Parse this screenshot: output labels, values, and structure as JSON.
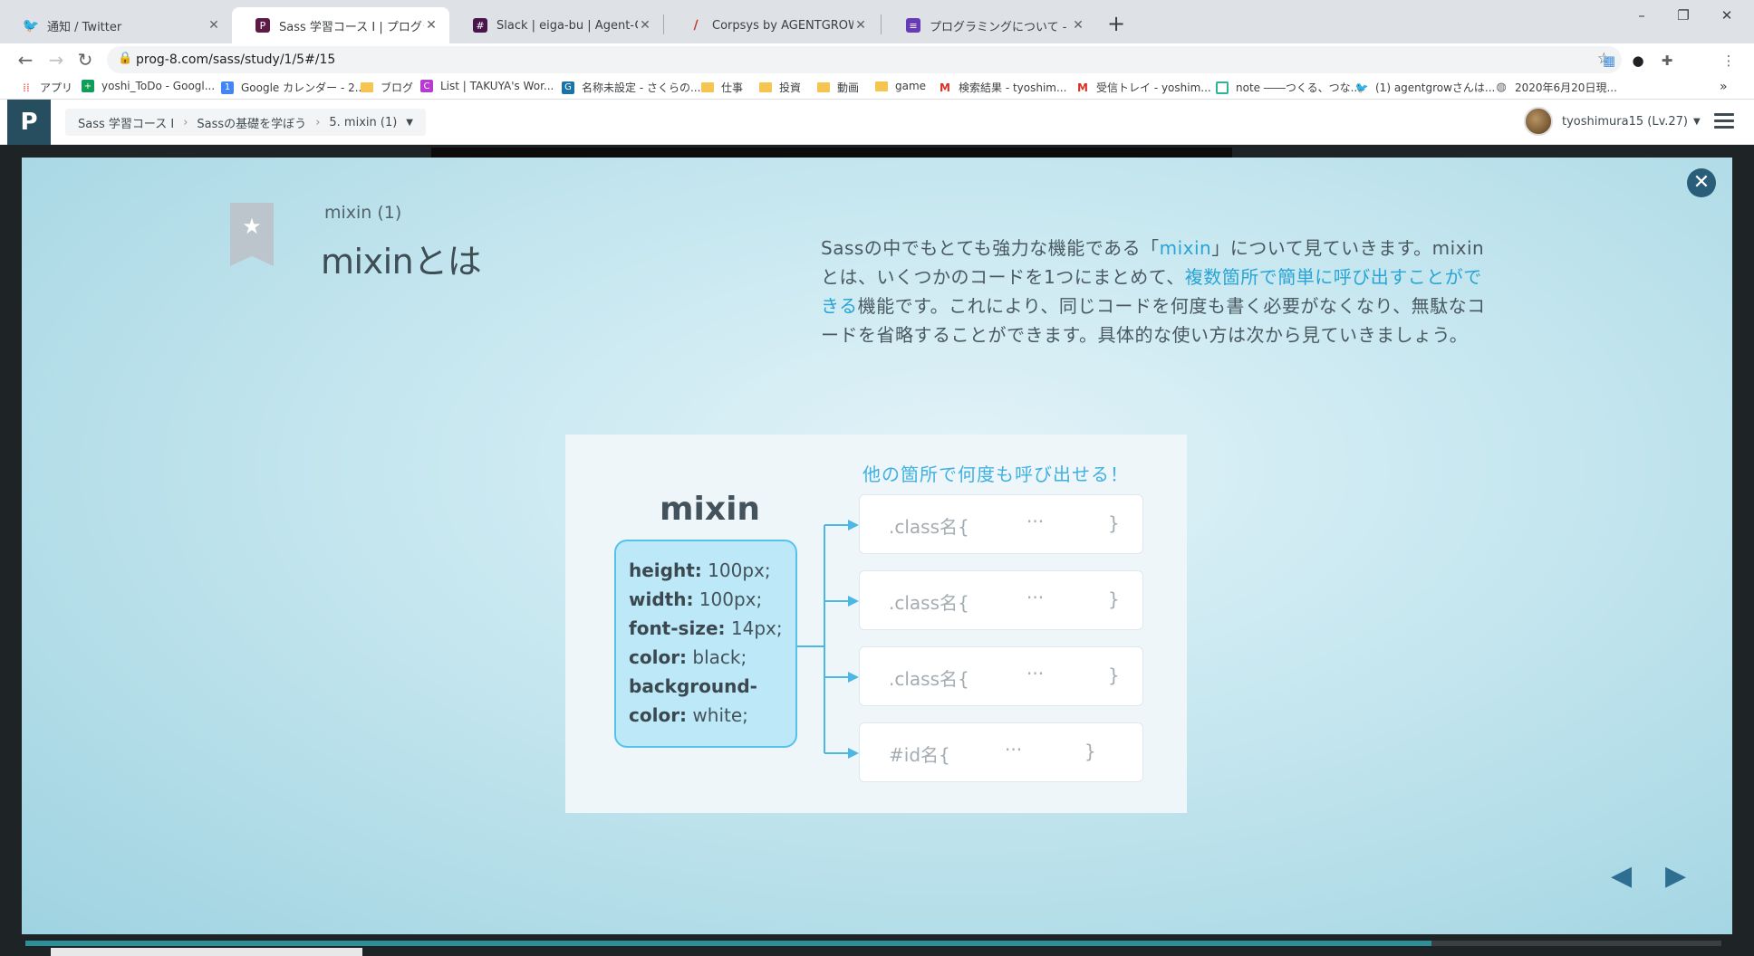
{
  "browser": {
    "tabs": [
      {
        "title": "通知 / Twitter",
        "icon": "twitter-icon",
        "color": "#1da1f2",
        "active": false
      },
      {
        "title": "Sass 学習コース I | プログラミングの入",
        "icon": "progate-icon",
        "color": "#5d1a46",
        "active": true
      },
      {
        "title": "Slack | eiga-bu | Agent-Grow",
        "icon": "slack-icon",
        "color": "#4a154b",
        "active": false
      },
      {
        "title": "Corpsys by AGENTGROW Inc.",
        "icon": "corpsys-icon",
        "color": "#c0392b",
        "active": false
      },
      {
        "title": "プログラミングについて - Google フォ",
        "icon": "google-forms-icon",
        "color": "#673ab7",
        "active": false
      }
    ],
    "new_tab": "+",
    "window_controls": {
      "minimize": "–",
      "restore": "❐",
      "close": "✕"
    },
    "url": "prog-8.com/sass/study/1/5#/15",
    "bookmarks": [
      {
        "label": "アプリ",
        "icon": "apps-grid-icon"
      },
      {
        "label": "yoshi_ToDo - Googl...",
        "icon": "google-sheets-icon"
      },
      {
        "label": "Google カレンダー - 2...",
        "icon": "google-calendar-icon"
      },
      {
        "label": "ブログ",
        "icon": "folder-icon"
      },
      {
        "label": "List | TAKUYA's Wor...",
        "icon": "list-icon"
      },
      {
        "label": "名称未設定 - さくらの...",
        "icon": "sakura-icon"
      },
      {
        "label": "仕事",
        "icon": "folder-icon"
      },
      {
        "label": "投資",
        "icon": "folder-icon"
      },
      {
        "label": "動画",
        "icon": "folder-icon"
      },
      {
        "label": "game",
        "icon": "folder-icon"
      },
      {
        "label": "検索結果 - tyoshim...",
        "icon": "gmail-icon"
      },
      {
        "label": "受信トレイ - yoshim...",
        "icon": "gmail-icon"
      },
      {
        "label": "note ――つくる、つな...",
        "icon": "note-icon"
      },
      {
        "label": "(1) agentgrowさんは...",
        "icon": "twitter-icon"
      },
      {
        "label": "2020年6月20日現...",
        "icon": "globe-icon"
      }
    ],
    "bookmarks_more": "»"
  },
  "header": {
    "breadcrumbs": [
      "Sass 学習コース I",
      "Sassの基礎を学ぼう",
      "5. mixin (1)"
    ],
    "user": "tyoshimura15 (Lv.27)"
  },
  "slide": {
    "subtitle": "mixin (1)",
    "title": "mixinとは",
    "desc": {
      "p1": "Sassの中でもとても強力な機能である「",
      "p2": "mixin",
      "p3": "」について見ていきます。mixinとは、いくつかのコードを1つにまとめて、",
      "p4": "複数箇所で簡単に呼び出すことができる",
      "p5": "機能です。これにより、同じコードを何度も書く必要がなくなり、無駄なコードを省略することができます。具体的な使い方は次から見ていきましょう。"
    },
    "diagram": {
      "caption": "他の箇所で何度も呼び出せる！",
      "mixin_title": "mixin",
      "props": [
        {
          "name": "height:",
          "value": " 100px;"
        },
        {
          "name": "width:",
          "value": " 100px;"
        },
        {
          "name": "font-size:",
          "value": " 14px;"
        },
        {
          "name": "color:",
          "value": " black;"
        },
        {
          "name": "background-",
          "value": ""
        },
        {
          "name": "color:",
          "value": " white;"
        }
      ],
      "targets": [
        {
          "selector": ".class名{",
          "dots": "···",
          "close": "}"
        },
        {
          "selector": ".class名{",
          "dots": "···",
          "close": "}"
        },
        {
          "selector": ".class名{",
          "dots": "···",
          "close": "}"
        },
        {
          "selector": "#id名{",
          "dots": "···",
          "close": "}"
        }
      ]
    },
    "nav": {
      "prev": "◀",
      "next": "▶"
    }
  },
  "colors": {
    "accent": "#29a4d4",
    "header_dark": "#264e5f",
    "close_button": "#2a5d79"
  }
}
